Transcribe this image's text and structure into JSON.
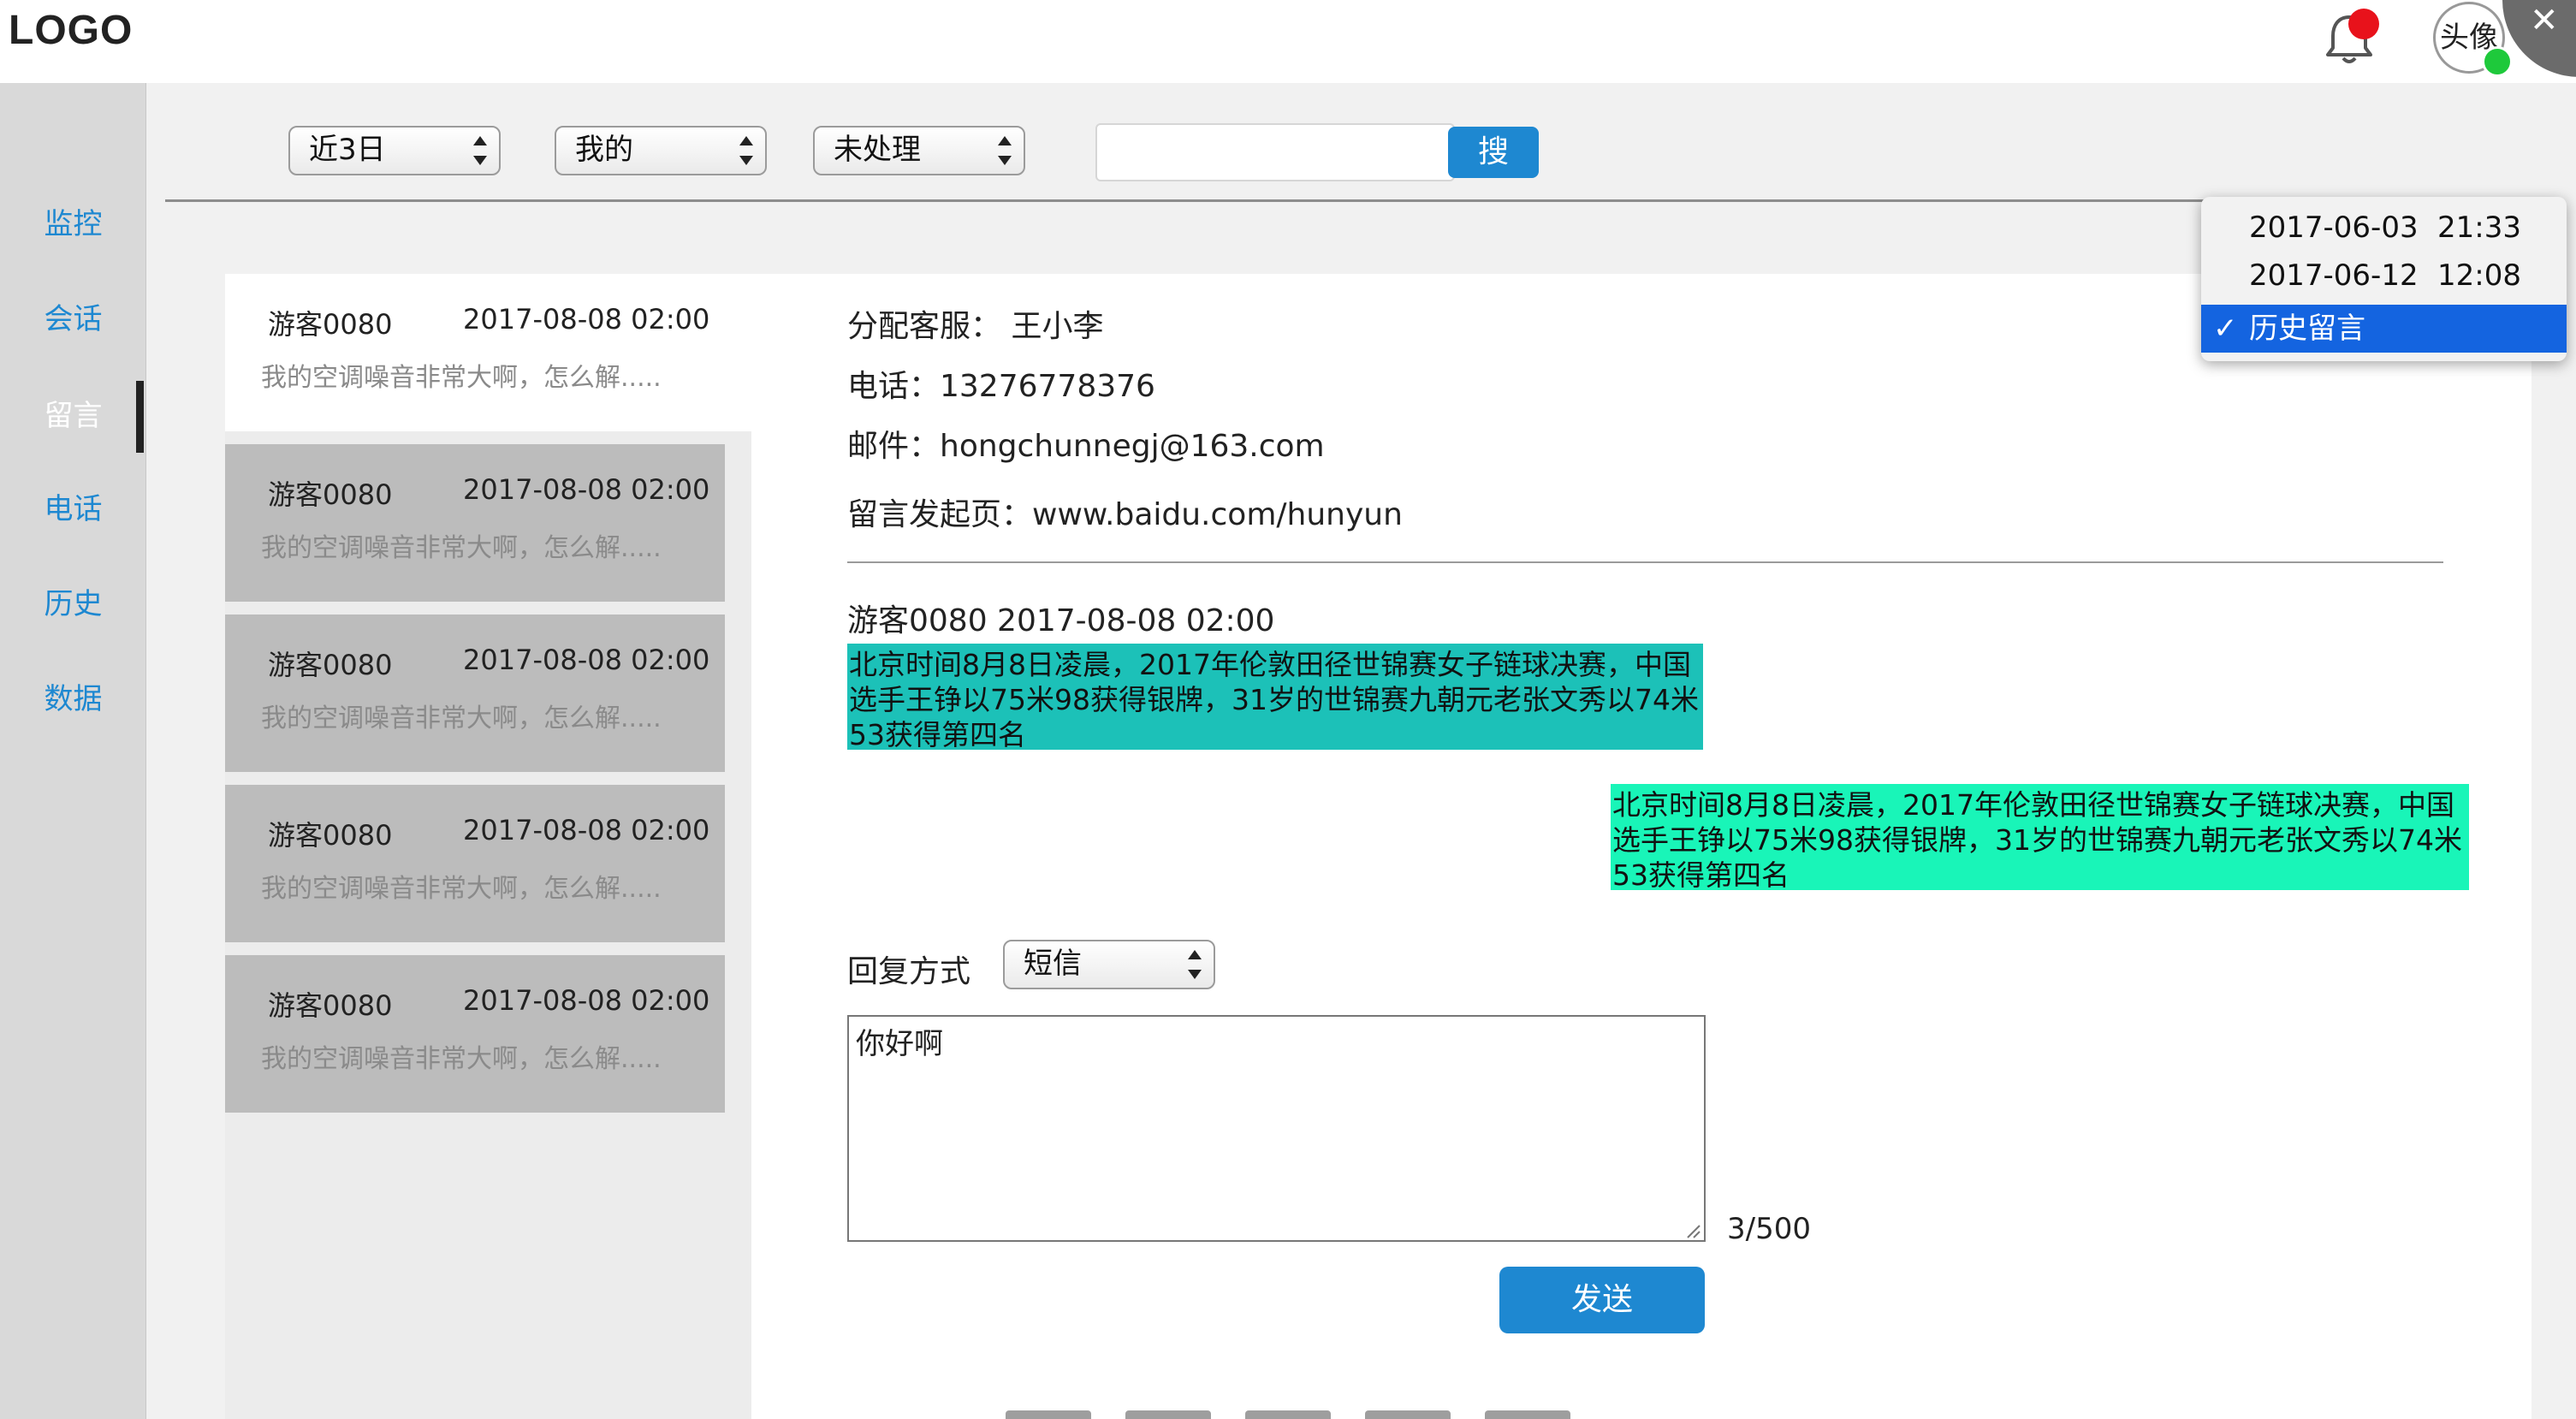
{
  "header": {
    "logo": "LOGO",
    "avatar_label": "头像",
    "close_glyph": "✕"
  },
  "sidebar": {
    "items": [
      {
        "label": "监控"
      },
      {
        "label": "会话"
      },
      {
        "label": "留言"
      },
      {
        "label": "电话"
      },
      {
        "label": "历史"
      },
      {
        "label": "数据"
      }
    ],
    "active_index": 2
  },
  "filters": {
    "period": "近3日",
    "scope": "我的",
    "status": "未处理",
    "search_value": "",
    "search_button": "搜"
  },
  "messages": [
    {
      "name": "游客0080",
      "time": "2017-08-08  02:00",
      "preview": "我的空调噪音非常大啊，怎么解....."
    },
    {
      "name": "游客0080",
      "time": "2017-08-08  02:00",
      "preview": "我的空调噪音非常大啊，怎么解....."
    },
    {
      "name": "游客0080",
      "time": "2017-08-08  02:00",
      "preview": "我的空调噪音非常大啊，怎么解....."
    },
    {
      "name": "游客0080",
      "time": "2017-08-08  02:00",
      "preview": "我的空调噪音非常大啊，怎么解....."
    },
    {
      "name": "游客0080",
      "time": "2017-08-08  02:00",
      "preview": "我的空调噪音非常大啊，怎么解....."
    }
  ],
  "detail": {
    "agent": "分配客服：  王小李",
    "phone": "电话：13276778376",
    "email": "邮件：hongchunnegj@163.com",
    "source_page": "留言发起页：www.baidu.com/hunyun",
    "chat_header": "游客0080   2017-08-08 02:00",
    "bubble_left": "北京时间8月8日凌晨，2017年伦敦田径世锦赛女子链球决赛，中国选手王铮以75米98获得银牌，31岁的世锦赛九朝元老张文秀以74米53获得第四名",
    "bubble_right": "北京时间8月8日凌晨，2017年伦敦田径世锦赛女子链球决赛，中国选手王铮以75米98获得银牌，31岁的世锦赛九朝元老张文秀以74米53获得第四名"
  },
  "reply": {
    "method_label": "回复方式",
    "method_value": "短信",
    "text": "你好啊",
    "char_count": "3/500",
    "send_button": "发送"
  },
  "history_dropdown": {
    "items": [
      {
        "date": "2017-06-03",
        "time": "21:33"
      },
      {
        "date": "2017-06-12",
        "time": "12:08"
      }
    ],
    "selected_label": "历史留言",
    "check_glyph": "✓"
  },
  "colors": {
    "accent": "#1e88d1",
    "bubble_customer": "#1cc1b8",
    "bubble_agent": "#19f5b8",
    "notification": "#e8121b",
    "online": "#1ec93b"
  }
}
